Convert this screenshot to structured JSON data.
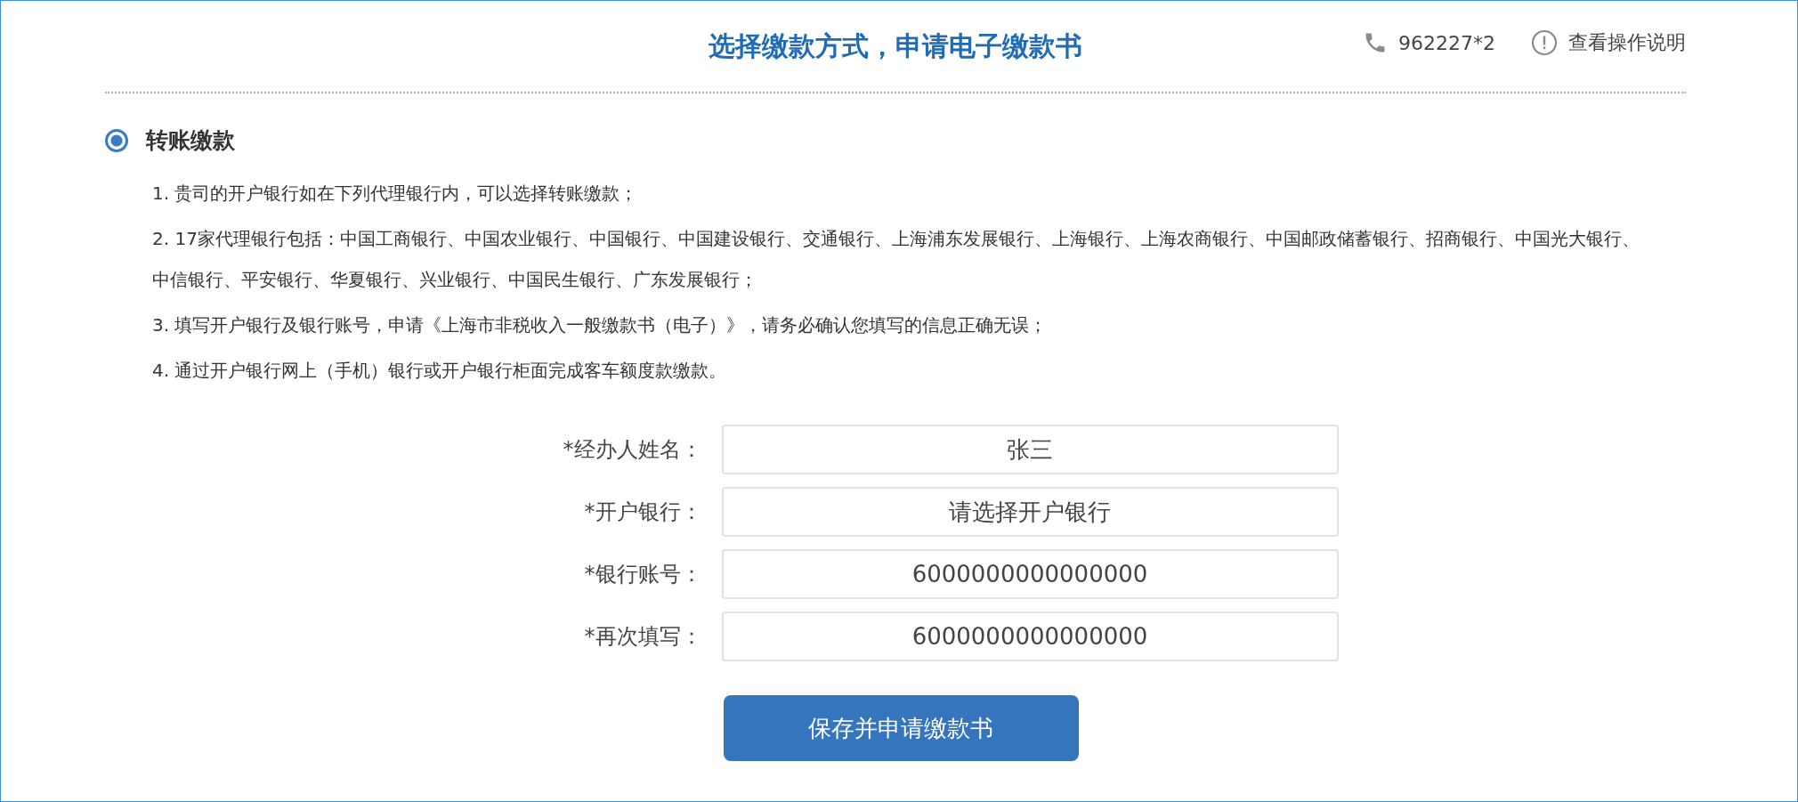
{
  "header": {
    "title": "选择缴款方式，申请电子缴款书",
    "phone": "962227*2",
    "help_link": "查看操作说明"
  },
  "payment_option": {
    "label": "转账缴款",
    "selected": true,
    "instructions": [
      "1. 贵司的开户银行如在下列代理银行内，可以选择转账缴款；",
      "2. 17家代理银行包括：中国工商银行、中国农业银行、中国银行、中国建设银行、交通银行、上海浦东发展银行、上海银行、上海农商银行、中国邮政储蓄银行、招商银行、中国光大银行、中信银行、平安银行、华夏银行、兴业银行、中国民生银行、广东发展银行；",
      "3. 填写开户银行及银行账号，申请《上海市非税收入一般缴款书（电子）》，请务必确认您填写的信息正确无误；",
      "4. 通过开户银行网上（手机）银行或开户银行柜面完成客车额度款缴款。"
    ]
  },
  "form": {
    "fields": [
      {
        "kind": "text",
        "label": "*经办人姓名：",
        "value": "张三"
      },
      {
        "kind": "select",
        "label": "*开户银行：",
        "placeholder": "请选择开户银行"
      },
      {
        "kind": "text",
        "label": "*银行账号：",
        "value": "6000000000000000"
      },
      {
        "kind": "text",
        "label": "*再次填写：",
        "value": "6000000000000000"
      }
    ],
    "submit_button": "保存并申请缴款书"
  }
}
